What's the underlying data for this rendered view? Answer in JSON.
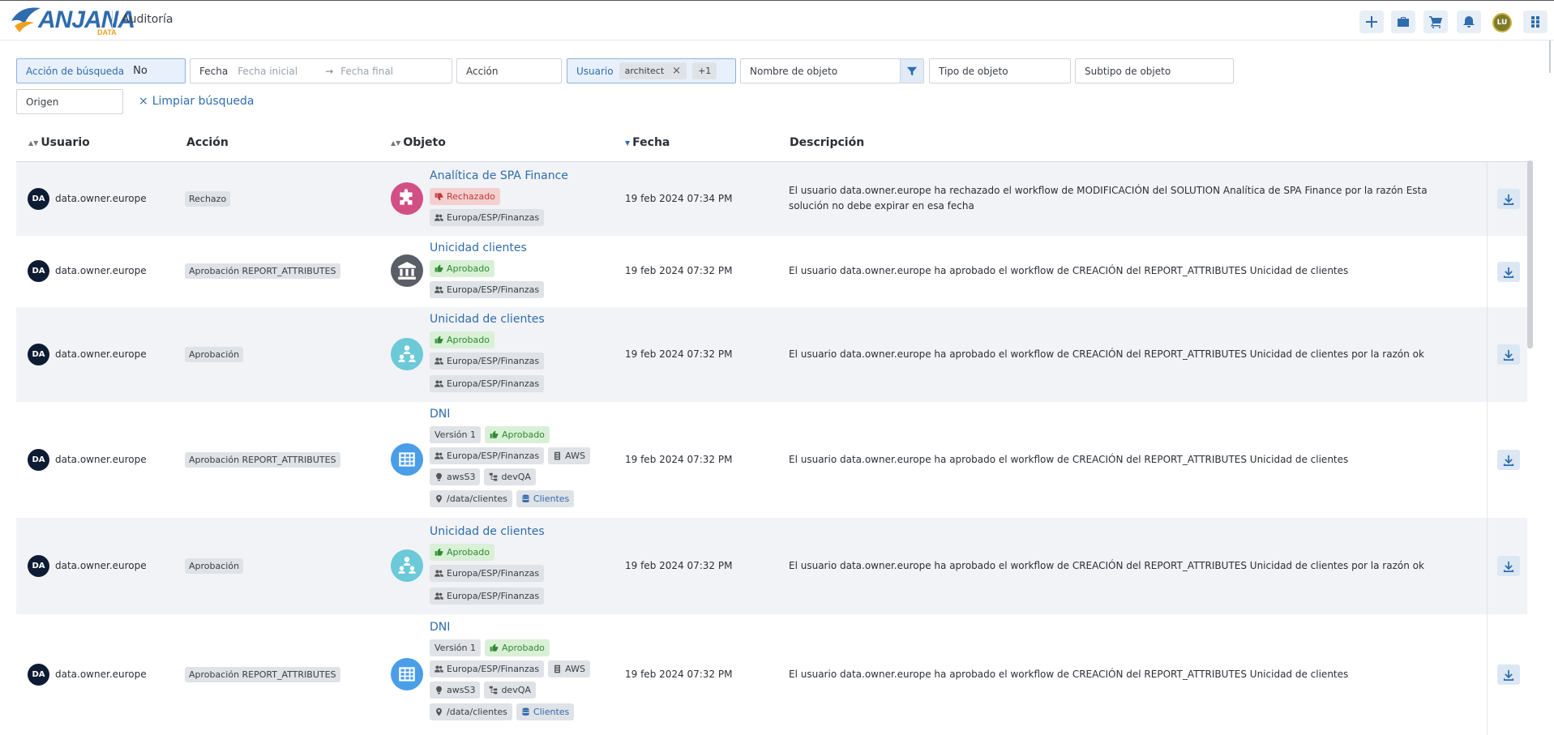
{
  "header": {
    "logo_text": "ANJANA",
    "logo_sub": "DATA",
    "title": "Auditoría",
    "buttons": [
      "plus-icon",
      "briefcase-icon",
      "cart-icon",
      "bell-icon",
      "apps-grid-icon"
    ],
    "user_initials": "LU"
  },
  "filters": {
    "search_action": {
      "label": "Acción de búsqueda",
      "value": "No"
    },
    "date": {
      "label": "Fecha",
      "start_placeholder": "Fecha inicial",
      "arrow": "→",
      "end_placeholder": "Fecha final"
    },
    "action": {
      "placeholder": "Acción"
    },
    "user": {
      "label": "Usuario",
      "chip": "architect",
      "chip_close": "×",
      "more": "+1"
    },
    "object_name": {
      "placeholder": "Nombre de objeto"
    },
    "object_type": {
      "placeholder": "Tipo de objeto"
    },
    "object_subtype": {
      "placeholder": "Subtipo de objeto"
    },
    "origin": {
      "placeholder": "Origen"
    },
    "clear_label": "Limpiar búsqueda",
    "clear_icon": "×"
  },
  "table": {
    "columns": {
      "user": "Usuario",
      "action": "Acción",
      "object": "Objeto",
      "date": "Fecha",
      "description": "Descripción"
    },
    "rows": [
      {
        "user_initials": "DA",
        "user": "data.owner.europe",
        "action": "Rechazo",
        "object_icon": "puzzle-icon",
        "object_color": "#d24f86",
        "object_title": "Analítica de SPA Finance",
        "status": "Rechazado",
        "tags": [
          "Europa/ESP/Finanzas"
        ],
        "date": "19 feb 2024 07:34 PM",
        "description": "El usuario data.owner.europe ha rechazado el workflow de MODIFICACIÓN del SOLUTION Analítica de SPA Finance por la razón Esta solución no debe expirar en esa fecha"
      },
      {
        "user_initials": "DA",
        "user": "data.owner.europe",
        "action": "Aprobación REPORT_ATTRIBUTES",
        "object_icon": "bank-icon",
        "object_color": "#5a5e66",
        "object_title": "Unicidad clientes",
        "status": "Aprobado",
        "tags": [
          "Europa/ESP/Finanzas"
        ],
        "date": "19 feb 2024 07:32 PM",
        "description": "El usuario data.owner.europe ha aprobado el workflow de CREACIÓN del REPORT_ATTRIBUTES Unicidad de clientes"
      },
      {
        "user_initials": "DA",
        "user": "data.owner.europe",
        "action": "Aprobación",
        "object_icon": "people-network-icon",
        "object_color": "#6cc9d8",
        "object_title": "Unicidad de clientes",
        "status": "Aprobado",
        "tags": [
          "Europa/ESP/Finanzas",
          "Europa/ESP/Finanzas"
        ],
        "date": "19 feb 2024 07:32 PM",
        "description": "El usuario data.owner.europe ha aprobado el workflow de CREACIÓN del REPORT_ATTRIBUTES Unicidad de clientes por la razón ok"
      },
      {
        "user_initials": "DA",
        "user": "data.owner.europe",
        "action": "Aprobación REPORT_ATTRIBUTES",
        "object_icon": "table-grid-icon",
        "object_color": "#4a9ee8",
        "object_title": "DNI",
        "version": "Versión 1",
        "status": "Aprobado",
        "tags": [
          "Europa/ESP/Finanzas",
          "AWS",
          "awsS3",
          "devQA",
          "/data/clientes",
          "Clientes"
        ],
        "date": "19 feb 2024 07:32 PM",
        "description": "El usuario data.owner.europe ha aprobado el workflow de CREACIÓN del REPORT_ATTRIBUTES Unicidad de clientes"
      },
      {
        "user_initials": "DA",
        "user": "data.owner.europe",
        "action": "Aprobación",
        "object_icon": "people-network-icon",
        "object_color": "#6cc9d8",
        "object_title": "Unicidad de clientes",
        "status": "Aprobado",
        "tags": [
          "Europa/ESP/Finanzas",
          "Europa/ESP/Finanzas"
        ],
        "date": "19 feb 2024 07:32 PM",
        "description": "El usuario data.owner.europe ha aprobado el workflow de CREACIÓN del REPORT_ATTRIBUTES Unicidad de clientes por la razón ok"
      },
      {
        "user_initials": "DA",
        "user": "data.owner.europe",
        "action": "Aprobación REPORT_ATTRIBUTES",
        "object_icon": "table-grid-icon",
        "object_color": "#4a9ee8",
        "object_title": "DNI",
        "version": "Versión 1",
        "status": "Aprobado",
        "tags": [
          "Europa/ESP/Finanzas",
          "AWS",
          "awsS3",
          "devQA",
          "/data/clientes",
          "Clientes"
        ],
        "date": "19 feb 2024 07:32 PM",
        "description": "El usuario data.owner.europe ha aprobado el workflow de CREACIÓN del REPORT_ATTRIBUTES Unicidad de clientes"
      }
    ]
  },
  "colors": {
    "accent": "#2f6cae",
    "rejected_bg": "#f5cfcf",
    "approved_bg": "#d9f0d6",
    "row_shade": "#f1f3f6"
  }
}
